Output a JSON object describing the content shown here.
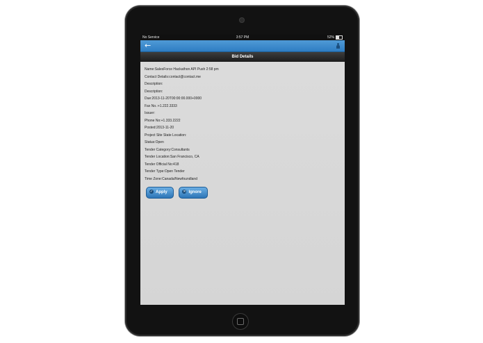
{
  "status_bar": {
    "carrier": "No Service",
    "time": "3:57 PM",
    "battery": "52%"
  },
  "header": {
    "back_icon": "arrow-left-icon",
    "user_icon": "person-icon",
    "title": "Bid Details"
  },
  "details": [
    "Name:SalesForce Hackathon API Push 2:58 pm",
    "Contact Details:contact@contact.me",
    "Description:",
    "Description:",
    "Due:2013-11-20T00:00:00.000+0000",
    "Fax No.:+1.222.3333",
    "Issuer:",
    "Phone No:+1.333.2222",
    "Posted:2013-11-20",
    "Project Site State Location:",
    "Status:Open",
    "Tender Category:Consultants",
    "Tender Location:San Francisco, CA",
    "Tender Official No:418",
    "Tender Type:Open Tender",
    "Time Zone:Canada/Newfoundland"
  ],
  "actions": {
    "apply_label": "Apply",
    "ignore_label": "Ignore",
    "apply_icon": "check-icon",
    "ignore_icon": "close-icon"
  },
  "colors": {
    "accent": "#2f7dc3",
    "titlebar": "#1c1c1c",
    "background": "#d8d8d8"
  }
}
